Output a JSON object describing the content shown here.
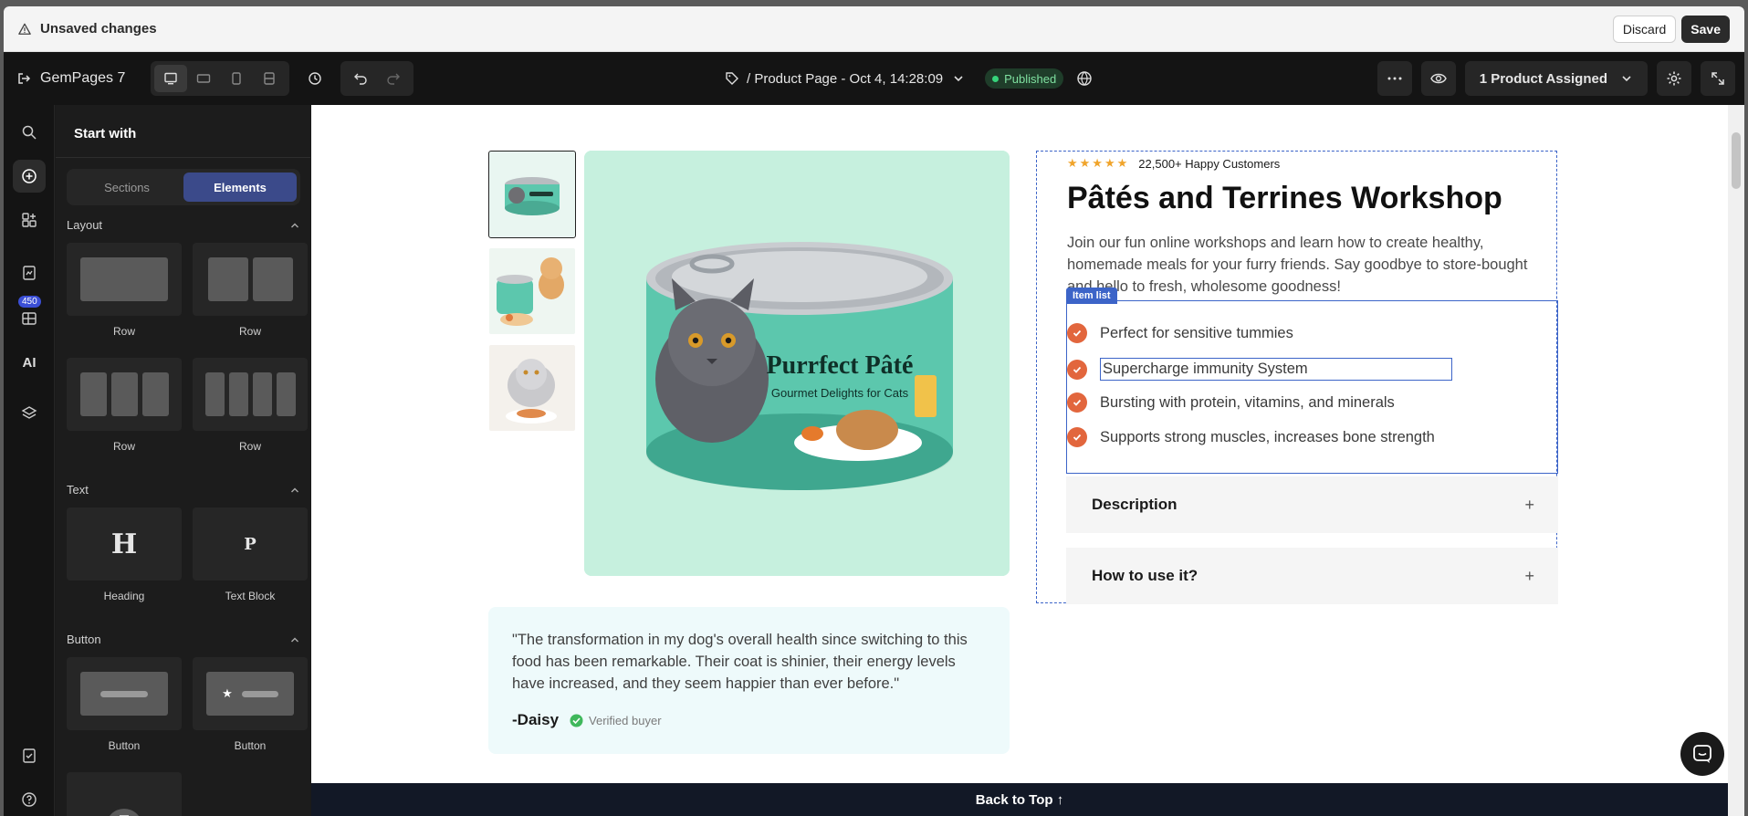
{
  "unsaved_bar": {
    "message": "Unsaved changes",
    "discard_label": "Discard",
    "save_label": "Save"
  },
  "toolbar": {
    "brand": "GemPages",
    "brand_version": "7",
    "page_title": "/ Product Page - Oct 4, 14:28:09",
    "status_badge": "Published",
    "assigned_label": "1 Product Assigned"
  },
  "rail": {
    "badge_count": "450",
    "ai_label": "AI"
  },
  "panel": {
    "title": "Start with",
    "tabs": [
      "Sections",
      "Elements"
    ],
    "active_tab": "Elements",
    "sections": {
      "layout": {
        "title": "Layout",
        "items": [
          "Row",
          "Row",
          "Row",
          "Row"
        ]
      },
      "text": {
        "title": "Text",
        "items": [
          {
            "glyph": "H",
            "label": "Heading"
          },
          {
            "glyph": "P",
            "label": "Text Block"
          }
        ]
      },
      "button": {
        "title": "Button",
        "items": [
          "Button",
          "Button"
        ]
      }
    }
  },
  "product": {
    "rating_text": "22,500+ Happy Customers",
    "stars": 5,
    "title": "Pâtés and Terrines Workshop",
    "description": "Join our fun online workshops and learn how to create healthy, homemade meals for your furry friends. Say goodbye to store-bought and hello to fresh, wholesome goodness!",
    "item_list_tag": "Item list",
    "bullets": [
      "Perfect for sensitive tummies",
      "Supercharge immunity System",
      "Bursting with protein, vitamins, and minerals",
      "Supports strong muscles, increases bone strength"
    ],
    "accordions": [
      "Description",
      "How to use it?"
    ],
    "accordion_icon": "+",
    "can_label": "Purrfect Pâté",
    "can_sublabel": "Gourmet Delights for Cats"
  },
  "review": {
    "quote": "\"The transformation in my dog's overall health since switching to this food has been remarkable. Their coat is shinier, their energy levels have increased, and they seem happier than ever before.\"",
    "author": "-Daisy",
    "verified": "Verified buyer"
  },
  "footer": {
    "back_to_top": "Back to Top ↑"
  },
  "colors": {
    "accent_blue": "#3c64c8",
    "check_orange": "#e2663d",
    "star": "#f0a42b",
    "published_green": "#36d37a",
    "product_bg": "#c6f0de"
  }
}
